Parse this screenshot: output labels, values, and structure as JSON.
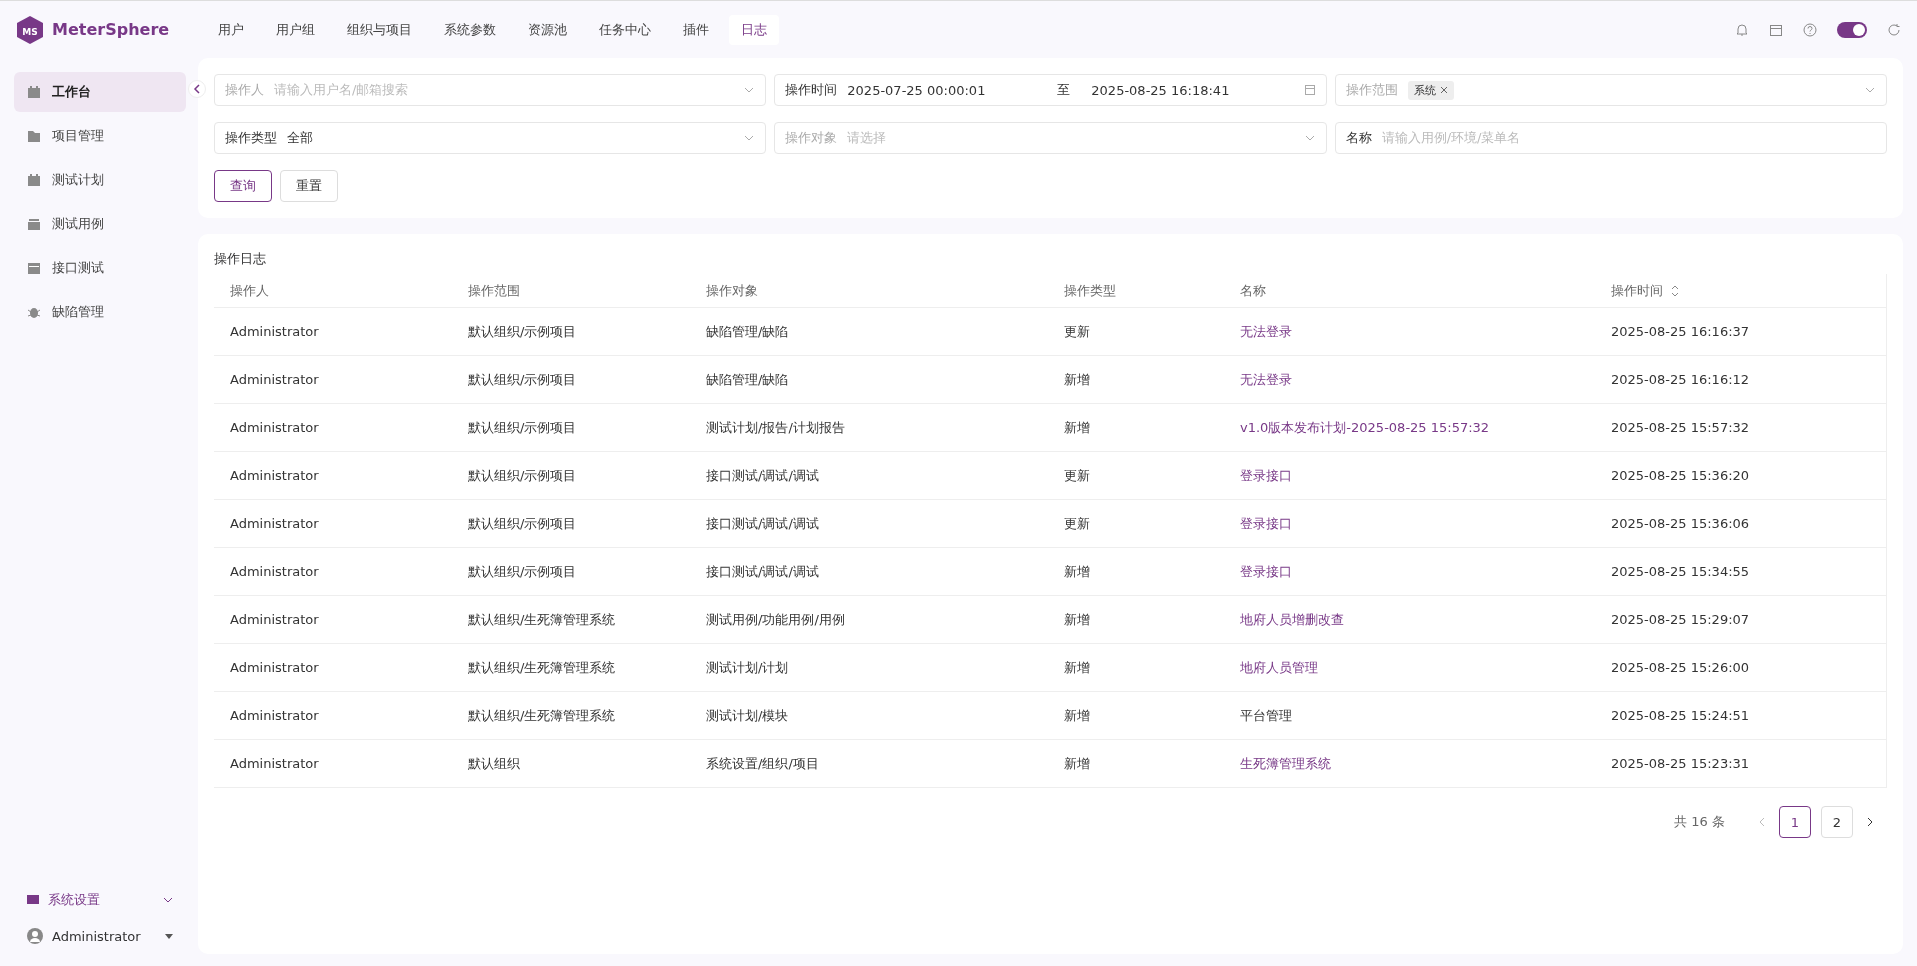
{
  "brand": {
    "name": "MeterSphere",
    "logo_text": "MS"
  },
  "nav": [
    {
      "label": "用户",
      "selected": false
    },
    {
      "label": "用户组",
      "selected": false
    },
    {
      "label": "组织与项目",
      "selected": false
    },
    {
      "label": "系统参数",
      "selected": false
    },
    {
      "label": "资源池",
      "selected": false
    },
    {
      "label": "任务中心",
      "selected": false
    },
    {
      "label": "插件",
      "selected": false
    },
    {
      "label": "日志",
      "selected": true
    }
  ],
  "theme_toggle": {
    "on": true
  },
  "sidebar": {
    "items": [
      {
        "label": "工作台",
        "selected": true,
        "kind": "board"
      },
      {
        "label": "项目管理",
        "selected": false,
        "kind": "folder"
      },
      {
        "label": "测试计划",
        "selected": false,
        "kind": "board"
      },
      {
        "label": "测试用例",
        "selected": false,
        "kind": "stack"
      },
      {
        "label": "接口测试",
        "selected": false,
        "kind": "api"
      },
      {
        "label": "缺陷管理",
        "selected": false,
        "kind": "bug"
      }
    ],
    "settings": {
      "label": "系统设置",
      "expanded": true
    },
    "user": {
      "name": "Administrator"
    }
  },
  "filters": [
    {
      "kind": "select",
      "label": "操作人",
      "placeholder": "请输入用户名/邮箱搜索"
    },
    {
      "kind": "daterange",
      "label": "操作时间",
      "start": "2025-07-25 00:00:01",
      "separator": "至",
      "end": "2025-08-25 16:18:41"
    },
    {
      "kind": "tags",
      "label": "操作范围",
      "tags": [
        "系统"
      ]
    },
    {
      "kind": "select",
      "label": "操作类型",
      "value": "全部"
    },
    {
      "kind": "select",
      "label": "操作对象",
      "placeholder": "请选择"
    },
    {
      "kind": "input",
      "label": "名称",
      "placeholder": "请输入用例/环境/菜单名"
    }
  ],
  "buttons": [
    {
      "label": "查询",
      "kind": "primary"
    },
    {
      "label": "重置",
      "kind": "default"
    }
  ],
  "table": {
    "title": "操作日志",
    "columns": [
      {
        "label": "操作人",
        "sortable": false
      },
      {
        "label": "操作范围",
        "sortable": false
      },
      {
        "label": "操作对象",
        "sortable": false
      },
      {
        "label": "操作类型",
        "sortable": false
      },
      {
        "label": "名称",
        "sortable": false
      },
      {
        "label": "操作时间",
        "sortable": true
      }
    ],
    "rows": [
      {
        "user": "Administrator",
        "scope": "默认组织/示例项目",
        "object": "缺陷管理/缺陷",
        "type": "更新",
        "name": "无法登录",
        "link": true,
        "time": "2025-08-25 16:16:37"
      },
      {
        "user": "Administrator",
        "scope": "默认组织/示例项目",
        "object": "缺陷管理/缺陷",
        "type": "新增",
        "name": "无法登录",
        "link": true,
        "time": "2025-08-25 16:16:12"
      },
      {
        "user": "Administrator",
        "scope": "默认组织/示例项目",
        "object": "测试计划/报告/计划报告",
        "type": "新增",
        "name": "v1.0版本发布计划-2025-08-25 15:57:32",
        "link": true,
        "time": "2025-08-25 15:57:32"
      },
      {
        "user": "Administrator",
        "scope": "默认组织/示例项目",
        "object": "接口测试/调试/调试",
        "type": "更新",
        "name": "登录接口",
        "link": true,
        "time": "2025-08-25 15:36:20"
      },
      {
        "user": "Administrator",
        "scope": "默认组织/示例项目",
        "object": "接口测试/调试/调试",
        "type": "更新",
        "name": "登录接口",
        "link": true,
        "time": "2025-08-25 15:36:06"
      },
      {
        "user": "Administrator",
        "scope": "默认组织/示例项目",
        "object": "接口测试/调试/调试",
        "type": "新增",
        "name": "登录接口",
        "link": true,
        "time": "2025-08-25 15:34:55"
      },
      {
        "user": "Administrator",
        "scope": "默认组织/生死簿管理系统",
        "object": "测试用例/功能用例/用例",
        "type": "新增",
        "name": "地府人员增删改查",
        "link": true,
        "time": "2025-08-25 15:29:07"
      },
      {
        "user": "Administrator",
        "scope": "默认组织/生死簿管理系统",
        "object": "测试计划/计划",
        "type": "新增",
        "name": "地府人员管理",
        "link": true,
        "time": "2025-08-25 15:26:00"
      },
      {
        "user": "Administrator",
        "scope": "默认组织/生死簿管理系统",
        "object": "测试计划/模块",
        "type": "新增",
        "name": "平台管理",
        "link": false,
        "time": "2025-08-25 15:24:51"
      },
      {
        "user": "Administrator",
        "scope": "默认组织",
        "object": "系统设置/组织/项目",
        "type": "新增",
        "name": "生死簿管理系统",
        "link": true,
        "time": "2025-08-25 15:23:31"
      }
    ]
  },
  "pagination": {
    "total": "共 16 条",
    "pages": [
      {
        "label": "1",
        "selected": true
      },
      {
        "label": "2",
        "selected": false
      }
    ]
  }
}
